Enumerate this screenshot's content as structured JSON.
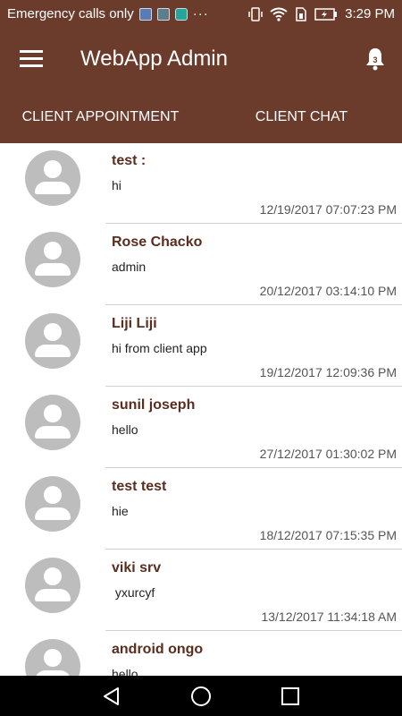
{
  "status_bar": {
    "carrier": "Emergency calls only",
    "dots": "···",
    "time": "3:29 PM"
  },
  "app_bar": {
    "title": "WebApp Admin",
    "notification_count": "3"
  },
  "tabs": [
    {
      "label": "CLIENT APPOINTMENT"
    },
    {
      "label": "CLIENT CHAT"
    }
  ],
  "active_tab": 1,
  "chats": [
    {
      "name": "test :",
      "message": "hi",
      "time": "12/19/2017 07:07:23 PM"
    },
    {
      "name": "Rose Chacko",
      "message": "admin",
      "time": "20/12/2017 03:14:10 PM"
    },
    {
      "name": "Liji Liji",
      "message": "hi from client app",
      "time": "19/12/2017 12:09:36 PM"
    },
    {
      "name": "sunil joseph",
      "message": "hello",
      "time": "27/12/2017 01:30:02 PM"
    },
    {
      "name": "test test",
      "message": "hie",
      "time": "18/12/2017 07:15:35 PM"
    },
    {
      "name": "viki srv",
      "message": " yxurcyf",
      "time": "13/12/2017 11:34:18 AM"
    },
    {
      "name": "android ongo",
      "message": "hello",
      "time": ""
    }
  ],
  "colors": {
    "primary": "#6b3c2b",
    "name_text": "#5a2d1f",
    "avatar_bg": "#bdbdbd"
  }
}
